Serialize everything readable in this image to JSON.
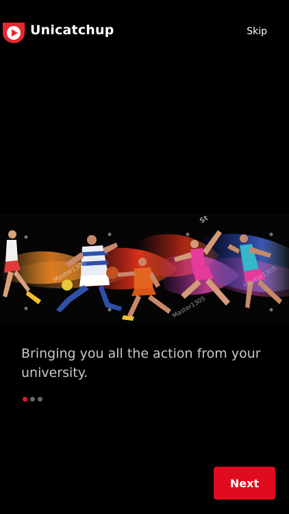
{
  "header": {
    "brand": "Unicatchup",
    "skip_label": "Skip",
    "logo_icon": "play-badge-icon",
    "brand_color": "#e8262f"
  },
  "hero": {
    "icon": "athletes-illustration",
    "watermark_texts": [
      "Master1305",
      "Master1305",
      "Master1305",
      "St"
    ]
  },
  "onboarding": {
    "caption": "Bringing you all the action from your university.",
    "pages_total": 3,
    "current_page": 1
  },
  "footer": {
    "next_label": "Next",
    "accent": "#e00b1e"
  }
}
